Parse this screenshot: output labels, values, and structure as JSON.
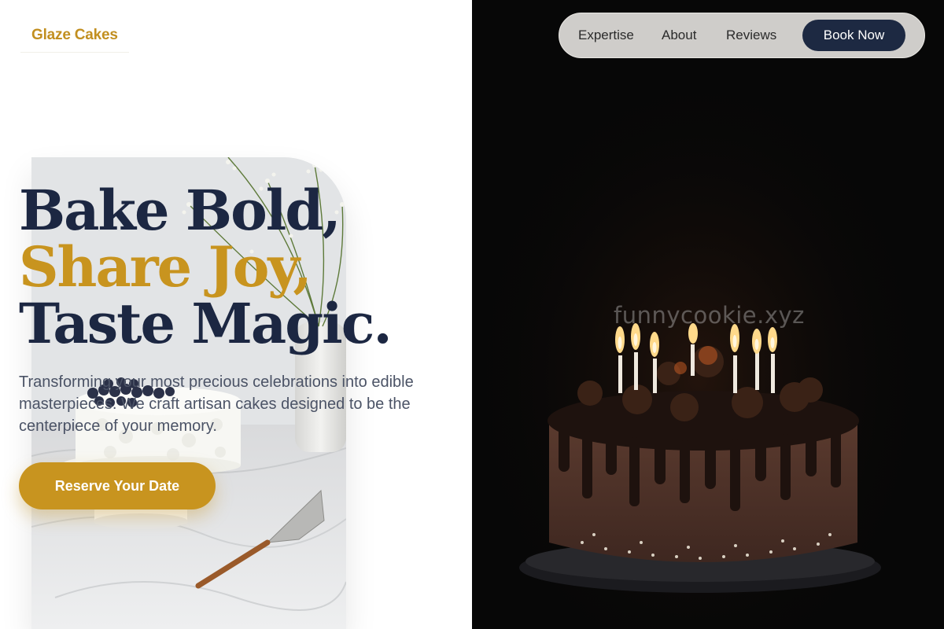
{
  "brand": {
    "logo_text": "Glaze Cakes"
  },
  "nav": {
    "links": [
      "Expertise",
      "About",
      "Reviews"
    ],
    "cta_label": "Book Now"
  },
  "hero": {
    "title_line1": "Bake Bold,",
    "title_line2": "Share Joy,",
    "title_line3": "Taste Magic.",
    "description": "Transforming your most precious celebrations into edible masterpieces. We craft artisan cakes designed to be the centerpiece of your memory.",
    "cta_label": "Reserve Your Date"
  },
  "media": {
    "left_photo": "white-cake-with-blueberries-photo",
    "right_photo": "chocolate-drip-cake-with-candles-photo",
    "watermark": "funnycookie.xyz"
  },
  "colors": {
    "navy": "#1c2742",
    "gold": "#c8941f",
    "logo_gold": "#c28f20",
    "body_text": "#4b5366",
    "nav_pill": "#cfcdca",
    "dark_bg": "#070707"
  }
}
